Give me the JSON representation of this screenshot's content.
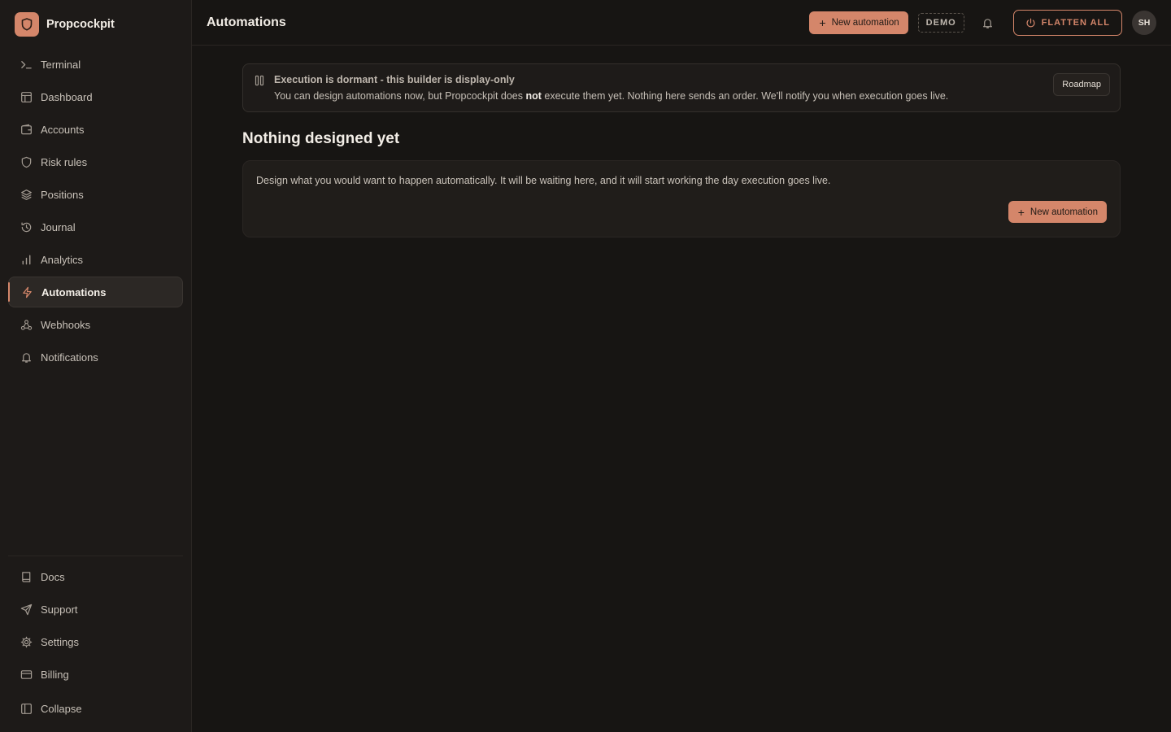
{
  "app": {
    "name": "Propcockpit"
  },
  "sidebar": {
    "items": [
      {
        "label": "Terminal",
        "icon": "terminal-icon"
      },
      {
        "label": "Dashboard",
        "icon": "dashboard-icon"
      },
      {
        "label": "Accounts",
        "icon": "wallet-icon"
      },
      {
        "label": "Risk rules",
        "icon": "shield-icon"
      },
      {
        "label": "Positions",
        "icon": "layers-icon"
      },
      {
        "label": "Journal",
        "icon": "history-icon"
      },
      {
        "label": "Analytics",
        "icon": "bar-chart-icon"
      },
      {
        "label": "Automations",
        "icon": "lightning-icon",
        "active": true
      },
      {
        "label": "Webhooks",
        "icon": "webhook-icon"
      },
      {
        "label": "Notifications",
        "icon": "bell-icon"
      }
    ],
    "bottom_items": [
      {
        "label": "Docs",
        "icon": "book-icon"
      },
      {
        "label": "Support",
        "icon": "send-icon"
      },
      {
        "label": "Settings",
        "icon": "gear-icon"
      },
      {
        "label": "Billing",
        "icon": "credit-card-icon"
      },
      {
        "label": "Collapse",
        "icon": "sidebar-collapse-icon"
      }
    ]
  },
  "header": {
    "title": "Automations",
    "new_automation_label": "New automation",
    "demo_badge": "DEMO",
    "flatten_label": "FLATTEN ALL",
    "avatar_initials": "SH"
  },
  "notice": {
    "title": "Execution is dormant - this builder is display-only",
    "body_prefix": "You can design automations now, but Propcockpit does ",
    "body_bold": "not",
    "body_suffix": " execute them yet. Nothing here sends an order. We'll notify you when execution goes live.",
    "roadmap_label": "Roadmap"
  },
  "empty_state": {
    "title": "Nothing designed yet",
    "text": "Design what you would want to happen automatically. It will be waiting here, and it will start working the day execution goes live.",
    "button_label": "New automation"
  },
  "colors": {
    "accent": "#d4866a",
    "background": "#171513",
    "sidebar": "#1d1a18"
  }
}
